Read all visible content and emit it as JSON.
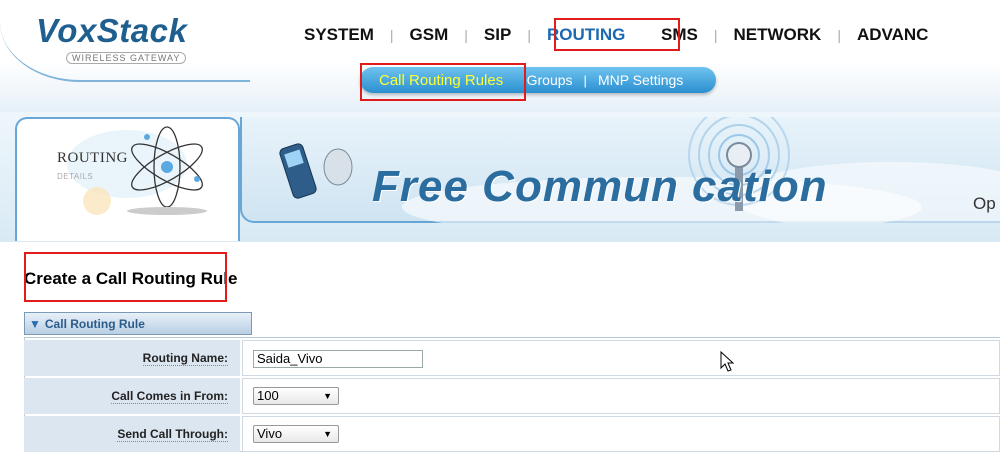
{
  "brand": {
    "name": "VoxStack",
    "tagline": "WIRELESS GATEWAY"
  },
  "nav": {
    "items": [
      "SYSTEM",
      "GSM",
      "SIP",
      "ROUTING",
      "SMS",
      "NETWORK",
      "ADVANC"
    ],
    "active": "ROUTING"
  },
  "subnav": {
    "items": [
      "Call Routing Rules",
      "Groups",
      "MNP Settings"
    ],
    "active": "Call Routing Rules"
  },
  "banner": {
    "section_title": "ROUTING",
    "section_sub": "DETAILS",
    "slogan": "Free Commun   cation",
    "slogan_tail": "Op"
  },
  "page": {
    "title": "Create a Call Routing Rule"
  },
  "section": {
    "title": "Call Routing Rule"
  },
  "form": {
    "routing_name": {
      "label": "Routing Name:",
      "value": "Saida_Vivo"
    },
    "call_comes_from": {
      "label": "Call Comes in From:",
      "value": "100"
    },
    "send_call_through": {
      "label": "Send Call Through:",
      "value": "Vivo"
    }
  },
  "colors": {
    "highlight": "#e01b1b",
    "accent": "#1b69b0",
    "subnav_active": "#ffff33"
  }
}
